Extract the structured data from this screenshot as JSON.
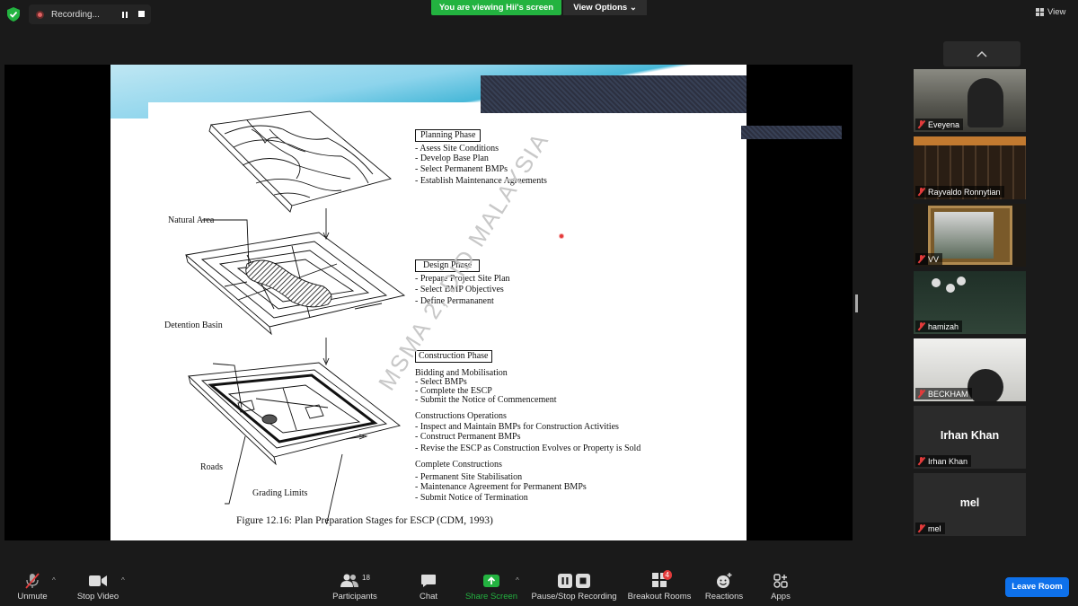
{
  "top": {
    "recording_label": "Recording...",
    "viewing_banner": "You are viewing Hii's screen",
    "view_options": "View Options",
    "view_label": "View"
  },
  "slide": {
    "labels": {
      "natural_area": "Natural Area",
      "detention_basin": "Detention Basin",
      "roads": "Roads",
      "grading_limits": "Grading Limits"
    },
    "planning": {
      "title": "Planning Phase",
      "items": [
        "- Asess Site Conditions",
        "- Develop Base Plan",
        "- Select Permanent BMPs",
        "- Establish Maintenance Agreements"
      ]
    },
    "design": {
      "title": "Design Phase",
      "items": [
        "- Prepare Project Site Plan",
        "- Select  BMP Objectives",
        "- Define Permananent"
      ]
    },
    "construction": {
      "title": "Construction Phase",
      "bidding_title": "Bidding and Mobilisation",
      "bidding_items": [
        "- Select BMPs",
        "- Complete the ESCP",
        "- Submit the Notice of Commencement"
      ],
      "ops_title": "Constructions Operations",
      "ops_items": [
        "- Inspect and Maintain BMPs for Construction Activities",
        "- Construct Permanent BMPs",
        "- Revise the ESCP as Construction Evolves or Property is Sold"
      ],
      "complete_title": "Complete Constructions",
      "complete_items": [
        "- Permanent Site Stabilisation",
        "- Maintenance Agreement for Permanent BMPs",
        "- Submit Notice of Termination"
      ]
    },
    "watermark": "MSMA 2, DID MALAYSIA",
    "caption": "Figure 12.16:   Plan Preparation Stages for ESCP (CDM, 1993)"
  },
  "participants": [
    {
      "name": "Eveyena",
      "bg": "#6b6b63"
    },
    {
      "name": "Rayvaldo Ronnytian",
      "bg": "#3a2a1c"
    },
    {
      "name": "VV",
      "bg": "#4a3a28"
    },
    {
      "name": "hamizah",
      "bg": "#203028"
    },
    {
      "name": "BECKHAM",
      "bg": "#d8d8d6"
    },
    {
      "name": "Irhan Khan",
      "bg": "#2b2b2b",
      "display": "Irhan Khan"
    },
    {
      "name": "mel",
      "bg": "#2b2b2b",
      "display": "mel"
    }
  ],
  "toolbar": {
    "unmute": "Unmute",
    "stop_video": "Stop Video",
    "participants": "Participants",
    "participants_count": "18",
    "chat": "Chat",
    "share_screen": "Share Screen",
    "pause_recording": "Pause/Stop Recording",
    "breakout": "Breakout Rooms",
    "breakout_badge": "4",
    "reactions": "Reactions",
    "apps": "Apps",
    "leave": "Leave Room"
  },
  "colors": {
    "share_green": "#23b340",
    "leave_blue": "#0e71eb",
    "muted_red": "#e23b3b"
  }
}
